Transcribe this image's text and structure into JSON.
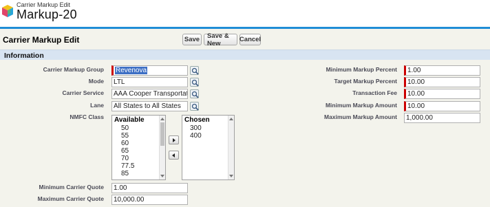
{
  "header": {
    "subtitle": "Carrier Markup Edit",
    "title": "Markup-20"
  },
  "page_block": {
    "title": "Carrier Markup Edit",
    "buttons": {
      "save": "Save",
      "save_new": "Save & New",
      "cancel": "Cancel"
    }
  },
  "section": {
    "title": "Information"
  },
  "fields_left": {
    "carrier_markup_group": {
      "label": "Carrier Markup Group",
      "value": "Revenova"
    },
    "mode": {
      "label": "Mode",
      "value": "LTL"
    },
    "carrier_service": {
      "label": "Carrier Service",
      "value": "AAA Cooper Transportatio"
    },
    "lane": {
      "label": "Lane",
      "value": "All States to All States"
    },
    "nmfc_class": {
      "label": "NMFC Class",
      "available_header": "Available",
      "available": [
        "50",
        "55",
        "60",
        "65",
        "70",
        "77.5",
        "85"
      ],
      "chosen_header": "Chosen",
      "chosen": [
        "300",
        "400"
      ]
    },
    "min_carrier_quote": {
      "label": "Minimum Carrier Quote",
      "value": "1.00"
    },
    "max_carrier_quote": {
      "label": "Maximum Carrier Quote",
      "value": "10,000.00"
    }
  },
  "fields_right": {
    "min_markup_percent": {
      "label": "Minimum Markup Percent",
      "value": "1.00"
    },
    "target_markup_percent": {
      "label": "Target Markup Percent",
      "value": "10.00"
    },
    "transaction_fee": {
      "label": "Transaction Fee",
      "value": "10.00"
    },
    "min_markup_amount": {
      "label": "Minimum Markup Amount",
      "value": "10.00"
    },
    "max_markup_amount": {
      "label": "Maximum Markup Amount",
      "value": "1,000.00"
    }
  },
  "icons": {
    "logo": "cube-logo-icon",
    "lookup": "magnifier-lookup-icon",
    "add": "arrow-right-icon",
    "remove": "arrow-left-icon"
  },
  "colors": {
    "accent": "#1f8dd6",
    "section_bg": "#d8e4f2",
    "required": "#cc0000",
    "panel_bg": "#f3f3ec"
  }
}
